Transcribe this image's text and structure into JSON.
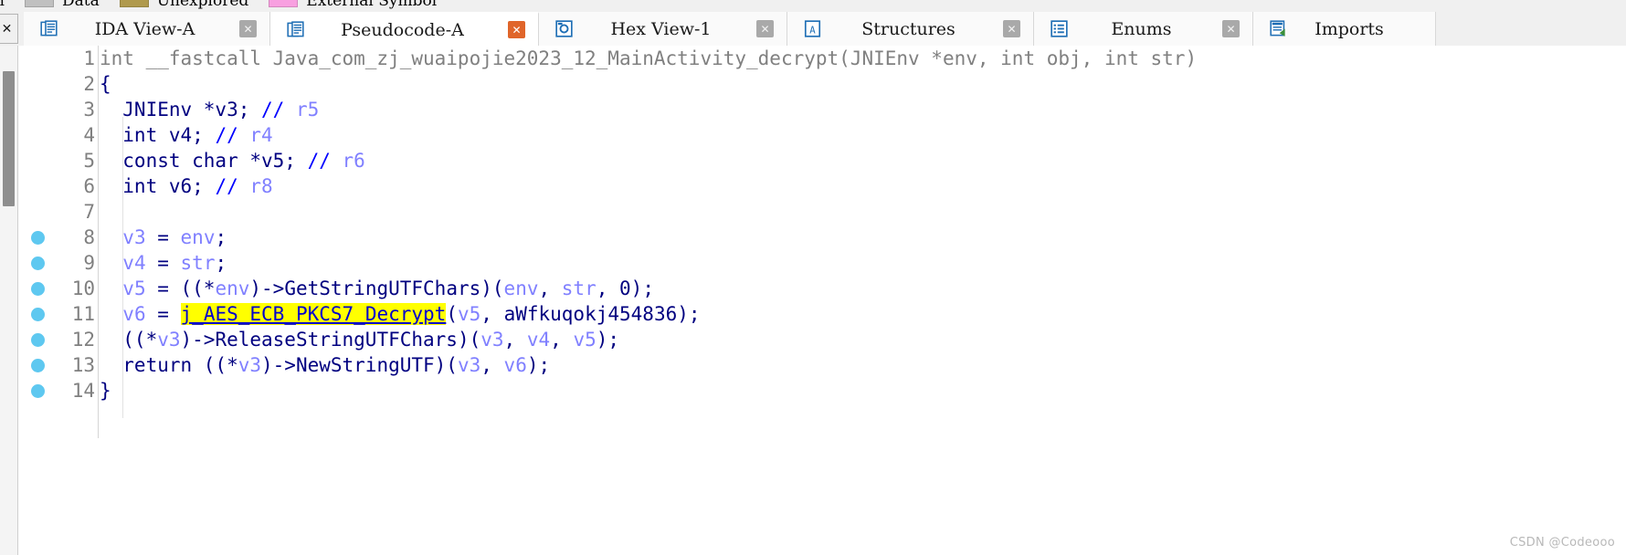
{
  "legend": {
    "items": [
      {
        "label": "ction",
        "color": "#c0c0c0"
      },
      {
        "label": "Data",
        "color": "#c0c0c0"
      },
      {
        "label": "Unexplored",
        "color": "#b09a4d"
      },
      {
        "label": "External Symbol",
        "color": "#f8a0e0"
      }
    ]
  },
  "tabbar": {
    "close_marker": "✕",
    "tabs": [
      {
        "label": "IDA View-A",
        "icon": "document-blue-icon",
        "active": false,
        "close_label": "✕"
      },
      {
        "label": "Pseudocode-A",
        "icon": "document-blue-icon",
        "active": true,
        "close_label": "✕"
      },
      {
        "label": "Hex View-1",
        "icon": "hexview-icon",
        "active": false,
        "close_label": "✕"
      },
      {
        "label": "Structures",
        "icon": "structures-icon",
        "active": false,
        "close_label": "✕"
      },
      {
        "label": "Enums",
        "icon": "enums-icon",
        "active": false,
        "close_label": "✕"
      },
      {
        "label": "Imports",
        "icon": "imports-icon",
        "active": false,
        "close_label": "✕"
      }
    ]
  },
  "code": {
    "lines": [
      {
        "number": "1",
        "marker": false,
        "tokens": [
          {
            "text": "int __fastcall Java_com_zj_wuaipojie2023_12_MainActivity_decrypt(JNIEnv *env, int obj, int str)",
            "cls": "t-plain"
          }
        ]
      },
      {
        "number": "2",
        "marker": false,
        "tokens": [
          {
            "text": "{",
            "cls": "t-punc"
          }
        ]
      },
      {
        "number": "3",
        "marker": false,
        "tokens": [
          {
            "text": "  JNIEnv *v3; ",
            "cls": "t-decl"
          },
          {
            "text": "// ",
            "cls": "t-cmt"
          },
          {
            "text": "r5",
            "cls": "t-reg"
          }
        ]
      },
      {
        "number": "4",
        "marker": false,
        "tokens": [
          {
            "text": "  int v4; ",
            "cls": "t-decl"
          },
          {
            "text": "// ",
            "cls": "t-cmt"
          },
          {
            "text": "r4",
            "cls": "t-reg"
          }
        ]
      },
      {
        "number": "5",
        "marker": false,
        "tokens": [
          {
            "text": "  const char *v5; ",
            "cls": "t-decl"
          },
          {
            "text": "// ",
            "cls": "t-cmt"
          },
          {
            "text": "r6",
            "cls": "t-reg"
          }
        ]
      },
      {
        "number": "6",
        "marker": false,
        "tokens": [
          {
            "text": "  int v6; ",
            "cls": "t-decl"
          },
          {
            "text": "// ",
            "cls": "t-cmt"
          },
          {
            "text": "r8",
            "cls": "t-reg"
          }
        ]
      },
      {
        "number": "7",
        "marker": false,
        "tokens": []
      },
      {
        "number": "8",
        "marker": true,
        "tokens": [
          {
            "text": "  ",
            "cls": "t-punc"
          },
          {
            "text": "v3",
            "cls": "t-var"
          },
          {
            "text": " = ",
            "cls": "t-punc"
          },
          {
            "text": "env",
            "cls": "t-var"
          },
          {
            "text": ";",
            "cls": "t-punc"
          }
        ]
      },
      {
        "number": "9",
        "marker": true,
        "tokens": [
          {
            "text": "  ",
            "cls": "t-punc"
          },
          {
            "text": "v4",
            "cls": "t-var"
          },
          {
            "text": " = ",
            "cls": "t-punc"
          },
          {
            "text": "str",
            "cls": "t-var"
          },
          {
            "text": ";",
            "cls": "t-punc"
          }
        ]
      },
      {
        "number": "10",
        "marker": true,
        "tokens": [
          {
            "text": "  ",
            "cls": "t-punc"
          },
          {
            "text": "v5",
            "cls": "t-var"
          },
          {
            "text": " = ((*",
            "cls": "t-punc"
          },
          {
            "text": "env",
            "cls": "t-var"
          },
          {
            "text": ")->GetStringUTFChars)(",
            "cls": "t-punc"
          },
          {
            "text": "env",
            "cls": "t-var"
          },
          {
            "text": ", ",
            "cls": "t-punc"
          },
          {
            "text": "str",
            "cls": "t-var"
          },
          {
            "text": ", ",
            "cls": "t-punc"
          },
          {
            "text": "0",
            "cls": "t-num"
          },
          {
            "text": ");",
            "cls": "t-punc"
          }
        ]
      },
      {
        "number": "11",
        "marker": true,
        "tokens": [
          {
            "text": "  ",
            "cls": "t-punc"
          },
          {
            "text": "v6",
            "cls": "t-var"
          },
          {
            "text": " = ",
            "cls": "t-punc"
          },
          {
            "text": "j_AES_ECB_PKCS7_Decrypt",
            "cls": "t-hl"
          },
          {
            "text": "(",
            "cls": "t-punc"
          },
          {
            "text": "v5",
            "cls": "t-var"
          },
          {
            "text": ", ",
            "cls": "t-punc"
          },
          {
            "text": "aWfkuqokj454836",
            "cls": "t-str"
          },
          {
            "text": ");",
            "cls": "t-punc"
          }
        ]
      },
      {
        "number": "12",
        "marker": true,
        "tokens": [
          {
            "text": "  ((*",
            "cls": "t-punc"
          },
          {
            "text": "v3",
            "cls": "t-var"
          },
          {
            "text": ")->ReleaseStringUTFChars)(",
            "cls": "t-punc"
          },
          {
            "text": "v3",
            "cls": "t-var"
          },
          {
            "text": ", ",
            "cls": "t-punc"
          },
          {
            "text": "v4",
            "cls": "t-var"
          },
          {
            "text": ", ",
            "cls": "t-punc"
          },
          {
            "text": "v5",
            "cls": "t-var"
          },
          {
            "text": ");",
            "cls": "t-punc"
          }
        ]
      },
      {
        "number": "13",
        "marker": true,
        "tokens": [
          {
            "text": "  return ((*",
            "cls": "t-punc"
          },
          {
            "text": "v3",
            "cls": "t-var"
          },
          {
            "text": ")->NewStringUTF)(",
            "cls": "t-punc"
          },
          {
            "text": "v3",
            "cls": "t-var"
          },
          {
            "text": ", ",
            "cls": "t-punc"
          },
          {
            "text": "v6",
            "cls": "t-var"
          },
          {
            "text": ");",
            "cls": "t-punc"
          }
        ]
      },
      {
        "number": "14",
        "marker": true,
        "tokens": [
          {
            "text": "}",
            "cls": "t-punc"
          }
        ]
      }
    ]
  },
  "watermark": "CSDN @Codeooo"
}
